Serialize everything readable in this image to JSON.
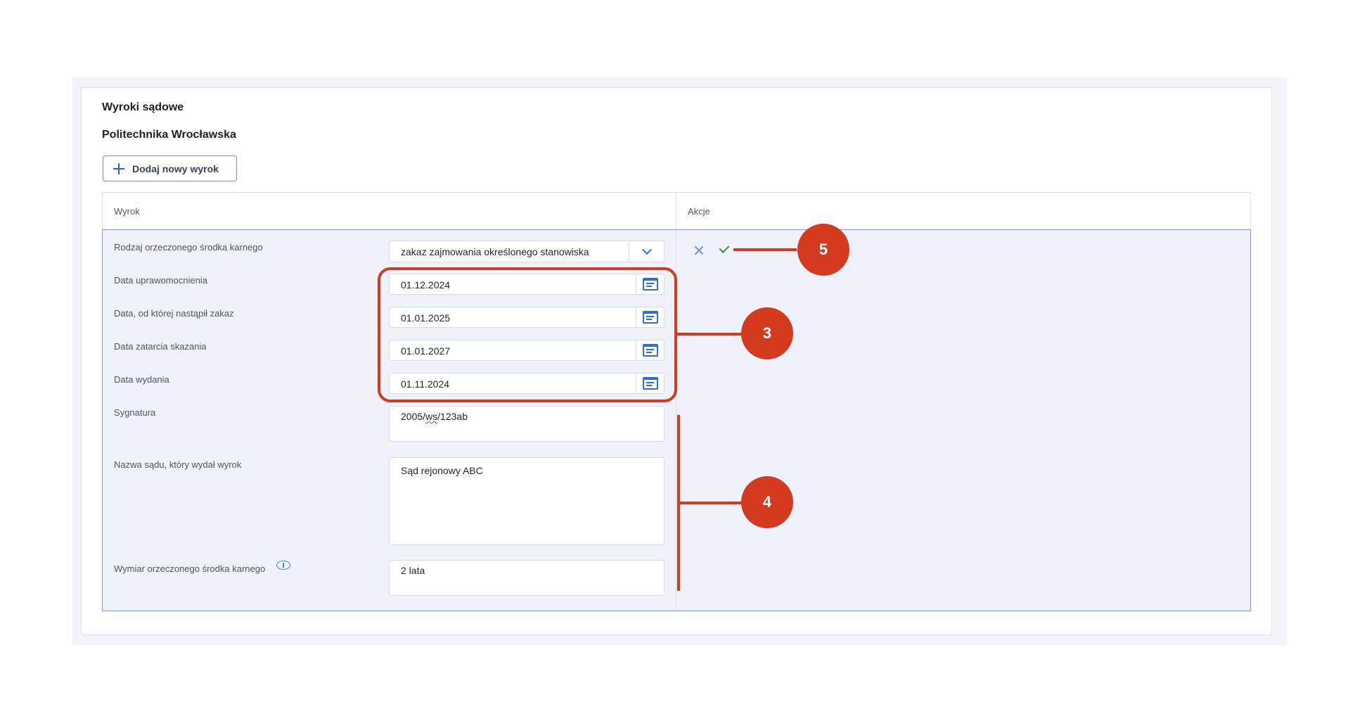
{
  "section": {
    "title": "Wyroki sądowe",
    "institution": "Politechnika Wrocławska",
    "add_button": "Dodaj nowy wyrok"
  },
  "table": {
    "headers": [
      "Wyrok",
      "Akcje"
    ]
  },
  "form": {
    "rodzaj": {
      "label": "Rodzaj orzeczonego środka karnego",
      "value": "zakaz zajmowania określonego stanowiska"
    },
    "data_uprawomocnienia": {
      "label": "Data uprawomocnienia",
      "value": "01.12.2024"
    },
    "data_zakazu": {
      "label": "Data, od której nastąpił zakaz",
      "value": "01.01.2025"
    },
    "data_zatarcia": {
      "label": "Data zatarcia skazania",
      "value": "01.01.2027"
    },
    "data_wydania": {
      "label": "Data wydania",
      "value": "01.11.2024"
    },
    "sygnatura": {
      "label": "Sygnatura",
      "value_pre": "2005/",
      "value_spell": "ws",
      "value_post": "/123ab"
    },
    "nazwa_sadu": {
      "label": "Nazwa sądu, który wydał wyrok",
      "value": "Sąd rejonowy ABC"
    },
    "wymiar": {
      "label": "Wymiar orzeczonego środka karnego",
      "value": "2 lata"
    }
  },
  "icons": {
    "calendar": "calendar-icon",
    "dropdown": "chevron-down-icon",
    "info": "info-icon",
    "cancel": "close-icon",
    "confirm": "check-icon",
    "add": "plus-icon"
  },
  "annotations": [
    "3",
    "4",
    "5"
  ],
  "colors": {
    "accent": "#2d6ed8",
    "annotation": "#d43a1e",
    "row_bg": "#eff2fb",
    "confirm": "#2e9140"
  }
}
